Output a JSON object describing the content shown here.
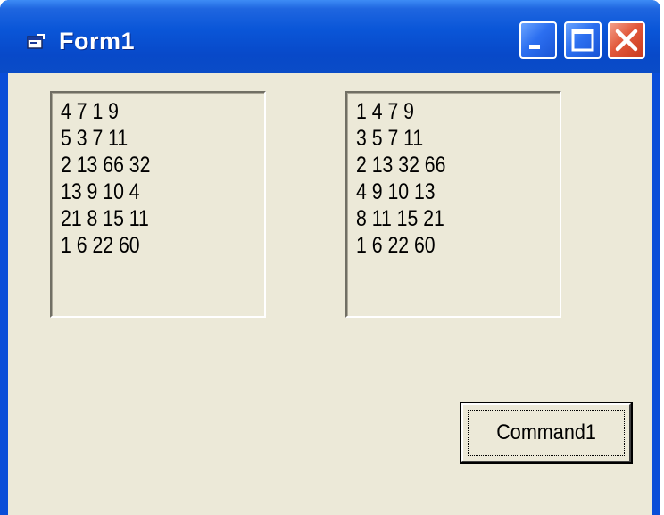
{
  "window": {
    "title": "Form1",
    "icon": "form-icon",
    "controls": {
      "minimize_icon": "minimize-icon",
      "maximize_icon": "maximize-icon",
      "close_icon": "close-icon"
    },
    "colors": {
      "titlebar": "#0a56d8",
      "client": "#ece9d8",
      "close": "#e2583a"
    }
  },
  "list_left": {
    "rows": [
      "4 7 1 9",
      "5 3 7 11",
      "2 13 66 32",
      "13 9 10 4",
      "21 8 15 11",
      "1 6 22 60"
    ]
  },
  "list_right": {
    "rows": [
      "1 4 7 9",
      "3 5 7 11",
      "2 13 32 66",
      "4 9 10 13",
      "8 11 15 21",
      "1 6 22 60"
    ]
  },
  "command_button": {
    "label": "Command1"
  }
}
